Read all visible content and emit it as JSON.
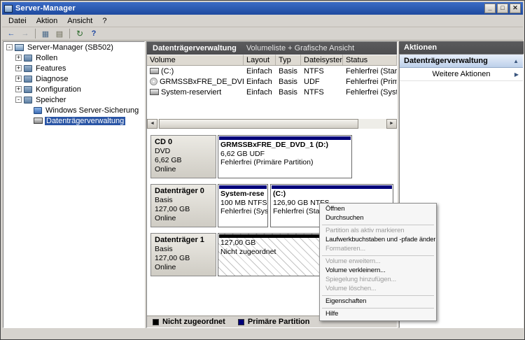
{
  "titlebar": {
    "title": "Server-Manager",
    "minimize": "_",
    "maximize": "□",
    "close": "✕"
  },
  "menubar": {
    "items": [
      "Datei",
      "Aktion",
      "Ansicht",
      "?"
    ]
  },
  "toolbar": {
    "back": "←",
    "forward": "→",
    "console_tree": "▦",
    "export": "▤",
    "refresh": "↻",
    "help": "?"
  },
  "tree": {
    "expand_glyph": "+",
    "collapse_glyph": "-",
    "root_label": "Server-Manager (SB502)",
    "items": [
      {
        "label": "Rollen"
      },
      {
        "label": "Features"
      },
      {
        "label": "Diagnose"
      },
      {
        "label": "Konfiguration"
      },
      {
        "label": "Speicher"
      }
    ],
    "children": [
      {
        "label": "Windows Server-Sicherung"
      },
      {
        "label": "Datenträgerverwaltung"
      }
    ]
  },
  "center": {
    "header": {
      "title": "Datenträgerverwaltung",
      "subtitle": "Volumeliste + Grafische Ansicht"
    },
    "table": {
      "columns": [
        "Volume",
        "Layout",
        "Typ",
        "Dateisystem",
        "Status"
      ],
      "rows": [
        {
          "volume": "(C:)",
          "layout": "Einfach",
          "typ": "Basis",
          "fs": "NTFS",
          "status": "Fehlerfrei (Startpartition"
        },
        {
          "volume": "GRMSSBxFRE_DE_DVD_1 (D:)",
          "layout": "Einfach",
          "typ": "Basis",
          "fs": "UDF",
          "status": "Fehlerfrei (Primäre Parti"
        },
        {
          "volume": "System-reserviert",
          "layout": "Einfach",
          "typ": "Basis",
          "fs": "NTFS",
          "status": "Fehlerfrei (System, Akti"
        }
      ]
    },
    "disks": [
      {
        "name": "CD 0",
        "kind": "DVD",
        "size": "6,62 GB",
        "state": "Online",
        "partitions": [
          {
            "title": "GRMSSBxFRE_DE_DVD_1  (D:)",
            "line2": "6,62 GB UDF",
            "line3": "Fehlerfrei (Primäre Partition)"
          }
        ]
      },
      {
        "name": "Datenträger 0",
        "kind": "Basis",
        "size": "127,00 GB",
        "state": "Online",
        "partitions": [
          {
            "title": "System-rese",
            "line2": "100 MB NTFS",
            "line3": "Fehlerfrei (Syst"
          },
          {
            "title": "(C:)",
            "line2": "126,90 GB NTFS",
            "line3": "Fehlerfrei (Startpa"
          }
        ]
      },
      {
        "name": "Datenträger 1",
        "kind": "Basis",
        "size": "127,00 GB",
        "state": "Online",
        "partitions": [
          {
            "title": "",
            "line2": "127,00 GB",
            "line3": "Nicht zugeordnet"
          }
        ]
      }
    ],
    "legend": [
      {
        "label": "Nicht zugeordnet",
        "color": "#000000"
      },
      {
        "label": "Primäre Partition",
        "color": "#00007a"
      }
    ],
    "scrollbar": {
      "left": "◄",
      "right": "►"
    }
  },
  "actions": {
    "panel_title": "Aktionen",
    "section_title": "Datenträgerverwaltung",
    "collapse_glyph": "▲",
    "more_label": "Weitere Aktionen",
    "more_glyph": "▶"
  },
  "context_menu": {
    "items": [
      {
        "label": "Öffnen",
        "enabled": true
      },
      {
        "label": "Durchsuchen",
        "enabled": true
      },
      {
        "label": "Partition als aktiv markieren",
        "enabled": false
      },
      {
        "label": "Laufwerkbuchstaben und -pfade ändern...",
        "enabled": true
      },
      {
        "label": "Formatieren...",
        "enabled": false
      },
      {
        "label": "Volume erweitern...",
        "enabled": false
      },
      {
        "label": "Volume verkleinern...",
        "enabled": true
      },
      {
        "label": "Spiegelung hinzufügen...",
        "enabled": false
      },
      {
        "label": "Volume löschen...",
        "enabled": false
      },
      {
        "label": "Eigenschaften",
        "enabled": true
      },
      {
        "label": "Hilfe",
        "enabled": true
      }
    ]
  },
  "colors": {
    "primary_partition_stripe": "#00007a",
    "unallocated_stripe": "#000000",
    "titlebar_blue": "#2b5fc0",
    "selection_blue": "#2a55a5"
  }
}
